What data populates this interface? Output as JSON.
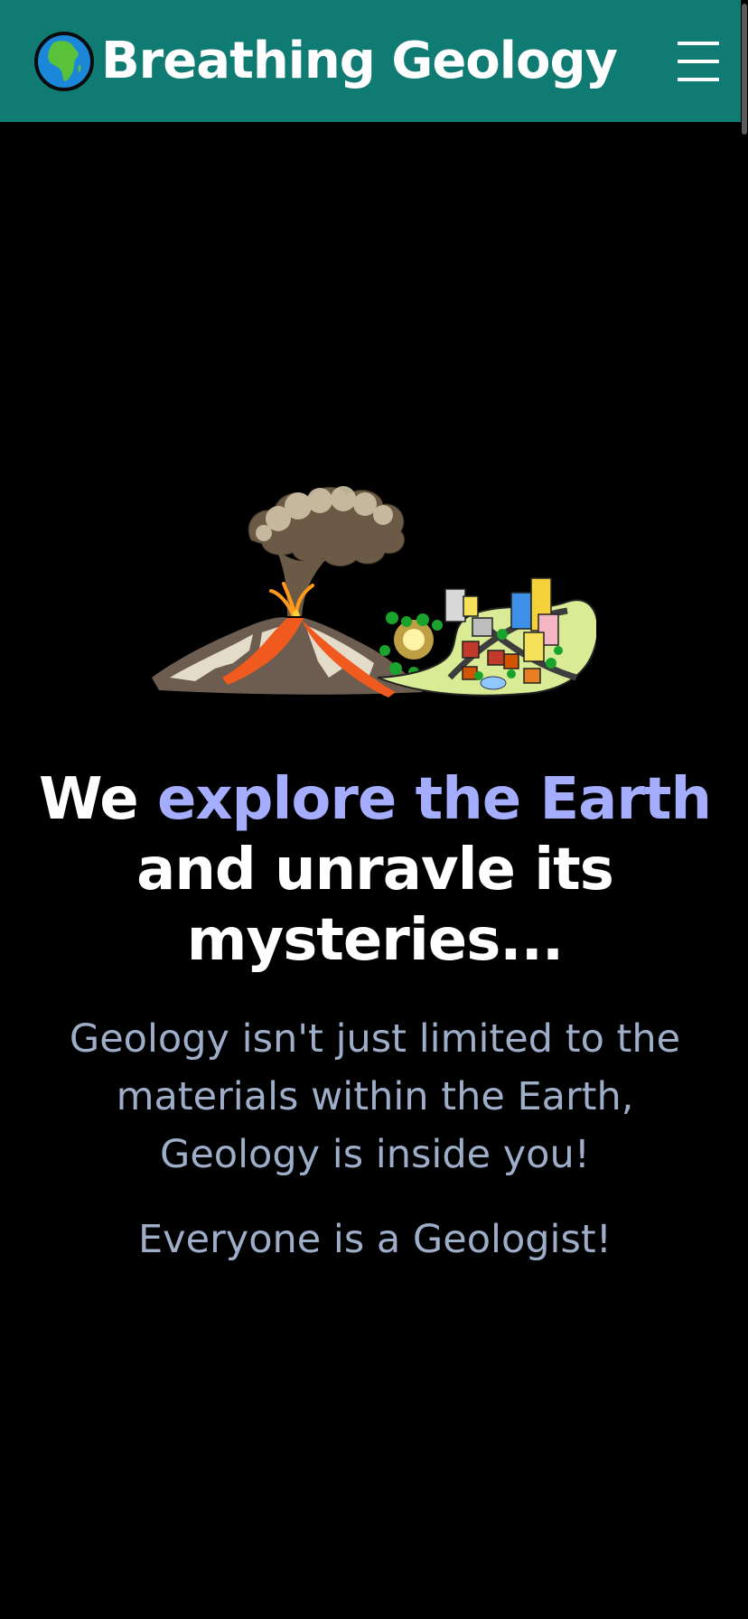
{
  "navbar": {
    "brand_title": "Breathing Geology",
    "brand_icon": "globe-africa-icon",
    "menu_icon": "hamburger-menu-icon",
    "background_color": "#107b73"
  },
  "hero": {
    "image_icon": "volcano-city-illustration",
    "headline_lead": "We ",
    "headline_accent": "explore the Earth",
    "headline_rest": " and unravle its mysteries...",
    "accent_color": "#a5adff",
    "subtext": "Geology isn't just limited to the materials within the Earth, Geology is inside you!",
    "tagline": "Everyone is a Geologist!",
    "subtext_color": "#9eadc8"
  }
}
